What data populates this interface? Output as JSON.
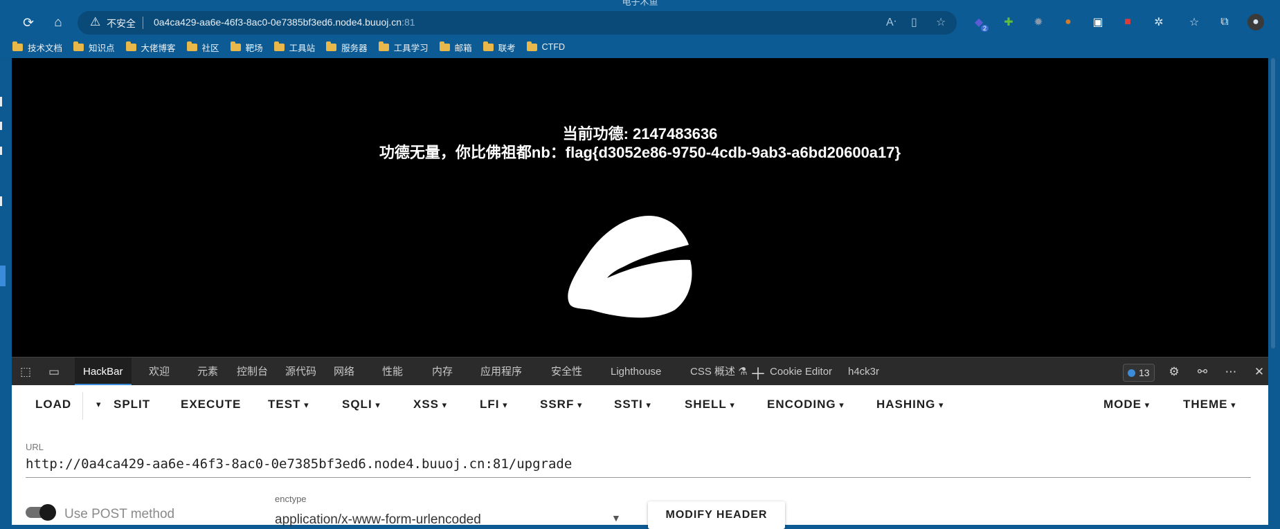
{
  "window": {
    "title": "电子木鱼"
  },
  "address_bar": {
    "security": "不安全",
    "host": "0a4ca429-aa6e-46f3-8ac0-0e7385bf3ed6.node4.buuoj.cn",
    "port": ":81"
  },
  "extensions": {
    "badge": "2"
  },
  "bookmarks": [
    "技术文档",
    "知识点",
    "大佬博客",
    "社区",
    "靶场",
    "工具站",
    "服务器",
    "工具学习",
    "邮箱",
    "联考",
    "CTFD"
  ],
  "page": {
    "merit": "当前功德: 2147483636",
    "flag_message": "功德无量，你比佛祖都nb：flag{d3052e86-9750-4cdb-9ab3-a6bd20600a17}"
  },
  "devtools": {
    "tabs": [
      "HackBar",
      "欢迎",
      "元素",
      "控制台",
      "源代码",
      "网络",
      "性能",
      "内存",
      "应用程序",
      "安全性",
      "Lighthouse",
      "CSS 概述 ⚗",
      "Cookie Editor",
      "h4ck3r"
    ],
    "issues_count": "13"
  },
  "hackbar": {
    "menu": [
      "LOAD",
      "SPLIT",
      "EXECUTE",
      "TEST",
      "SQLI",
      "XSS",
      "LFI",
      "SSRF",
      "SSTI",
      "SHELL",
      "ENCODING",
      "HASHING",
      "MODE",
      "THEME"
    ],
    "url_label": "URL",
    "url_value": "http://0a4ca429-aa6e-46f3-8ac0-0e7385bf3ed6.node4.buuoj.cn:81/upgrade",
    "post_label": "Use POST method",
    "post_enabled": true,
    "enctype_label": "enctype",
    "enctype_value": "application/x-www-form-urlencoded",
    "modify_header": "MODIFY HEADER"
  }
}
